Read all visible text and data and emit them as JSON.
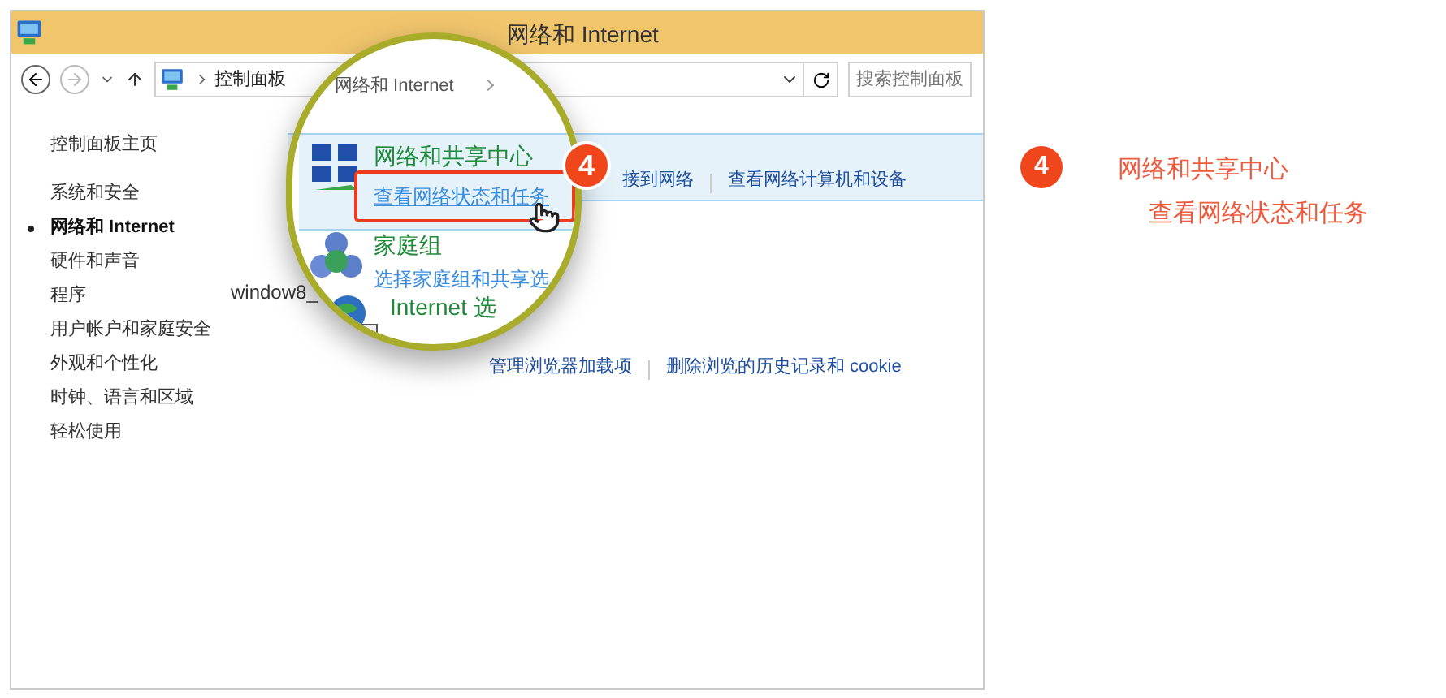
{
  "window": {
    "title": "网络和 Internet"
  },
  "address_bar": {
    "breadcrumb": "控制面板",
    "search": {
      "placeholder": "搜索控制面板"
    }
  },
  "sidebar": {
    "items": [
      {
        "label": "控制面板主页",
        "kind": "home",
        "selected": false
      },
      {
        "label": "系统和安全",
        "kind": "category",
        "selected": false
      },
      {
        "label": "网络和 Internet",
        "kind": "category",
        "selected": true
      },
      {
        "label": "硬件和声音",
        "kind": "category",
        "selected": false
      },
      {
        "label": "程序",
        "kind": "category",
        "selected": false
      },
      {
        "label": "用户帐户和家庭安全",
        "kind": "category",
        "selected": false
      },
      {
        "label": "外观和个性化",
        "kind": "category",
        "selected": false
      },
      {
        "label": "时钟、语言和区域",
        "kind": "category",
        "selected": false
      },
      {
        "label": "轻松使用",
        "kind": "category",
        "selected": false
      }
    ]
  },
  "categories": [
    {
      "selected": true,
      "links": [
        "接到网络",
        "查看网络计算机和设备"
      ]
    },
    {
      "selected": false
    },
    {
      "selected": false,
      "links": [
        "管理浏览器加载项",
        "删除浏览的历史记录和 cookie"
      ]
    }
  ],
  "overlay_label": "window8_",
  "magnifier": {
    "breadcrumb": "网络和 Internet",
    "badge": "4",
    "items": [
      {
        "kind": "network",
        "title": "网络和共享中心",
        "link": "查看网络状态和任务",
        "selected": true
      },
      {
        "kind": "homegroup",
        "title": "家庭组",
        "link": "选择家庭组和共享选",
        "selected": false
      },
      {
        "kind": "internet",
        "title": "Internet 选",
        "selected": false
      }
    ]
  },
  "step": {
    "number": "4",
    "lines": [
      "网络和共享中心",
      "查看网络状态和任务"
    ]
  }
}
